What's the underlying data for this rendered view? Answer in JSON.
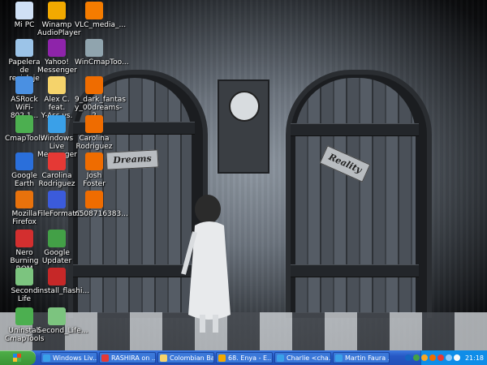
{
  "desktop": {
    "icons": [
      {
        "label": "Mi PC",
        "icon": "computer-icon",
        "color": "#cfe0f5"
      },
      {
        "label": "Papelera de\nreciclaje",
        "icon": "recycle-bin-icon",
        "color": "#9cc4e8"
      },
      {
        "label": "ASRock\nWiFi-802.1...",
        "icon": "wifi-icon",
        "color": "#4a90e2"
      },
      {
        "label": "CmapTools",
        "icon": "cmaptools-icon",
        "color": "#4caf50"
      },
      {
        "label": "Google Earth",
        "icon": "globe-icon",
        "color": "#2a6fdb"
      },
      {
        "label": "Mozilla Firefox",
        "icon": "firefox-icon",
        "color": "#e8720c"
      },
      {
        "label": "Nero Burning\nROM",
        "icon": "nero-icon",
        "color": "#d32f2f"
      },
      {
        "label": "Second Life",
        "icon": "second-life-icon",
        "color": "#7cc47f"
      },
      {
        "label": "Uninstall\nCmapTools",
        "icon": "uninstall-icon",
        "color": "#4caf50"
      },
      {
        "label": "Winamp\nAudioPlayer",
        "icon": "winamp-icon",
        "color": "#f2a900"
      },
      {
        "label": "Yahoo!\nMessenger c...",
        "icon": "yahoo-icon",
        "color": "#8e24aa"
      },
      {
        "label": "Alex C. feat.\nY-Ass vs. D...",
        "icon": "folder-icon",
        "color": "#f5d36b"
      },
      {
        "label": "Windows Live\nMessenger",
        "icon": "messenger-icon",
        "color": "#3aa0e8"
      },
      {
        "label": "Carolina\nRodriguez",
        "icon": "pdf-icon",
        "color": "#e53935"
      },
      {
        "label": "FileFormatC...",
        "icon": "music-file-icon",
        "color": "#3b5bdb"
      },
      {
        "label": "Google\nUpdater",
        "icon": "google-updater-icon",
        "color": "#43a047"
      },
      {
        "label": "install_flashi...",
        "icon": "flash-icon",
        "color": "#c62828"
      },
      {
        "label": "Second_Life...",
        "icon": "second-life-icon",
        "color": "#7cc47f"
      },
      {
        "label": "VLC_media_...",
        "icon": "vlc-icon",
        "color": "#f57c00"
      },
      {
        "label": "WinCmapToo...",
        "icon": "application-icon",
        "color": "#90a4ae"
      },
      {
        "label": "9_dark_fantas\ny_00dreams-\n2",
        "icon": "image-file-icon",
        "color": "#ef6c00"
      },
      {
        "label": "Carolina\nRodriguez",
        "icon": "image-file-icon",
        "color": "#ef6c00"
      },
      {
        "label": "Josh Foster",
        "icon": "image-file-icon",
        "color": "#ef6c00"
      },
      {
        "label": "n508716383...",
        "icon": "image-file-icon",
        "color": "#ef6c00"
      }
    ],
    "wallpaper": {
      "sign_left": "Dreams",
      "sign_right": "Reality"
    }
  },
  "taskbar": {
    "start_label": "",
    "tasks": [
      {
        "label": "Windows Liv...",
        "icon": "messenger-icon",
        "color": "#3aa0e8"
      },
      {
        "label": "RASHIRA on ...",
        "icon": "ie-icon",
        "color": "#e53935"
      },
      {
        "label": "Colombian Ba...",
        "icon": "folder-icon",
        "color": "#f5d36b"
      },
      {
        "label": "68. Enya - E...",
        "icon": "winamp-icon",
        "color": "#f2a900"
      },
      {
        "label": "Charlie <cha...",
        "icon": "messenger-icon",
        "color": "#3aa0e8"
      },
      {
        "label": "Martin Faura ...",
        "icon": "messenger-icon",
        "color": "#3aa0e8"
      }
    ],
    "tray_icons": [
      "#1565c0",
      "#43a047",
      "#f9a825",
      "#ef6c00",
      "#e53935",
      "#90caf9",
      "#fafafa"
    ],
    "time": "21:18"
  }
}
